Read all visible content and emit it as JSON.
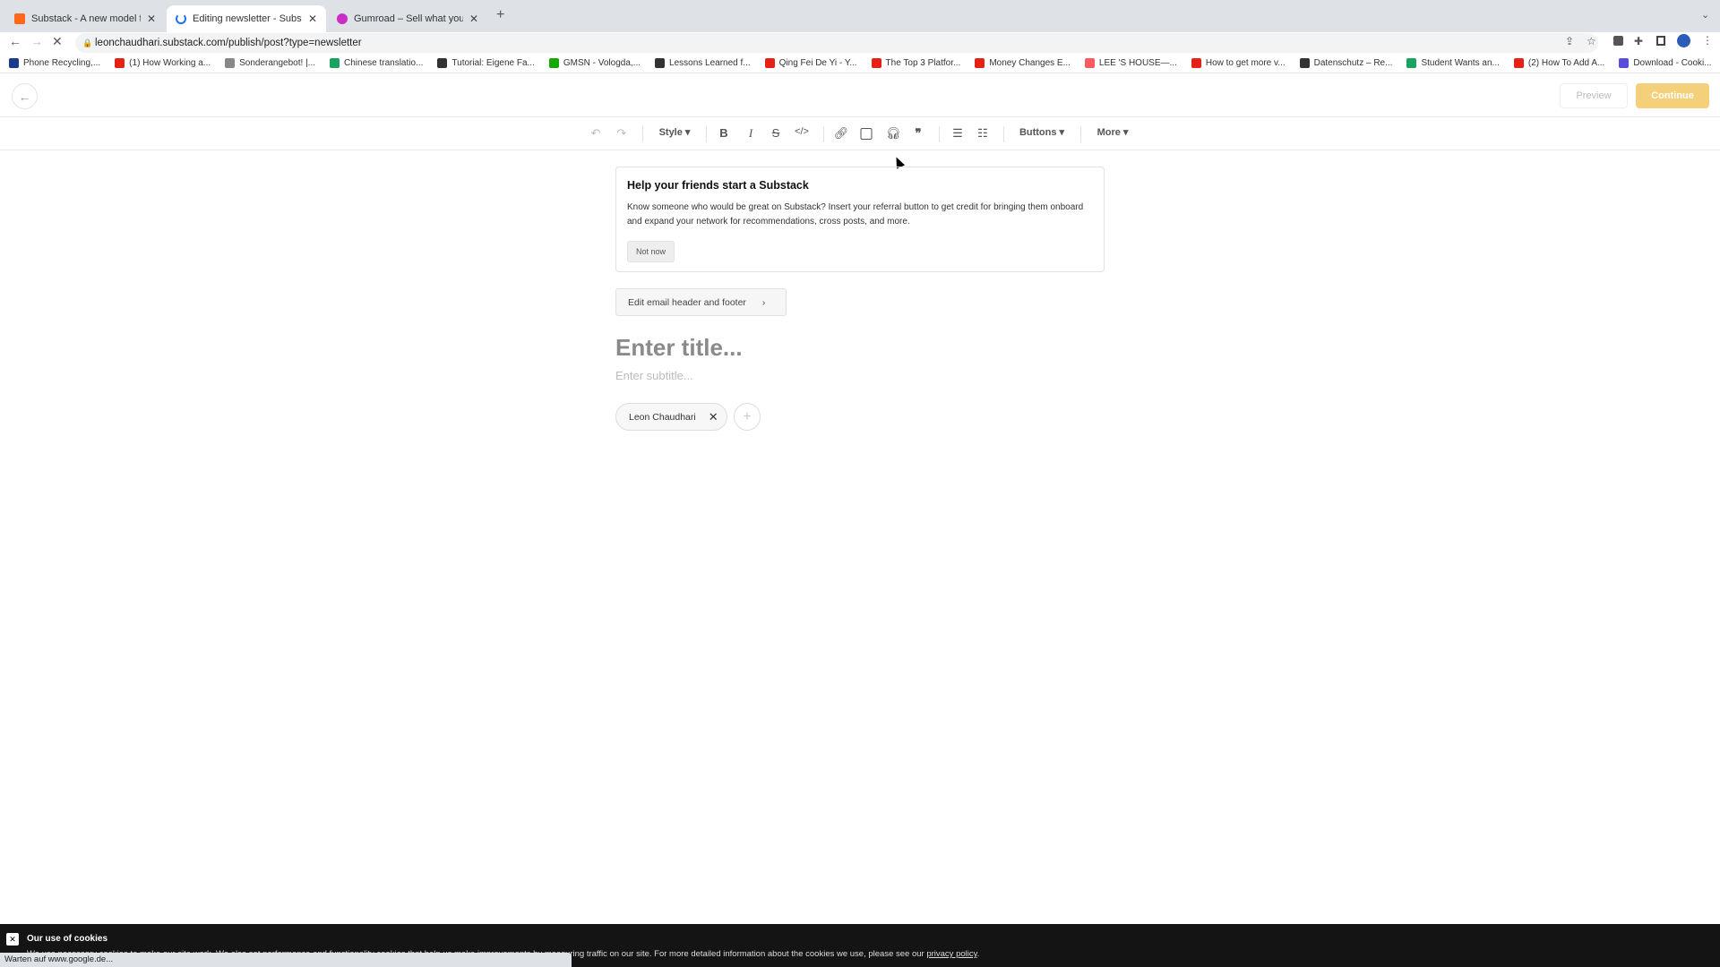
{
  "browser": {
    "tabs": [
      {
        "title": "Substack - A new model for pu",
        "icon": "substack-icon",
        "color": "#ff6719"
      },
      {
        "title": "Editing newsletter - Substack",
        "icon": "loading-spinner-icon",
        "color": "#1a73e8"
      },
      {
        "title": "Gumroad – Sell what you know",
        "icon": "gumroad-icon",
        "color": "#c92ec7"
      }
    ],
    "url": "leonchaudhari.substack.com/publish/post?type=newsletter",
    "bookmarks": [
      {
        "label": "Phone Recycling,...",
        "color": "#1a3a8a"
      },
      {
        "label": "(1) How Working a...",
        "color": "#e62117"
      },
      {
        "label": "Sonderangebot! |...",
        "color": "#888888"
      },
      {
        "label": "Chinese translatio...",
        "color": "#1aa260"
      },
      {
        "label": "Tutorial: Eigene Fa...",
        "color": "#333333"
      },
      {
        "label": "GMSN - Vologda,...",
        "color": "#14a800"
      },
      {
        "label": "Lessons Learned f...",
        "color": "#333333"
      },
      {
        "label": "Qing Fei De Yi - Y...",
        "color": "#e62117"
      },
      {
        "label": "The Top 3 Platfor...",
        "color": "#e62117"
      },
      {
        "label": "Money Changes E...",
        "color": "#e62117"
      },
      {
        "label": "LEE 'S HOUSE—...",
        "color": "#ff5a5f"
      },
      {
        "label": "How to get more v...",
        "color": "#e62117"
      },
      {
        "label": "Datenschutz – Re...",
        "color": "#333333"
      },
      {
        "label": "Student Wants an...",
        "color": "#1aa260"
      },
      {
        "label": "(2) How To Add A...",
        "color": "#e62117"
      },
      {
        "label": "Download - Cooki...",
        "color": "#5b4ddb"
      }
    ],
    "status": "Warten auf www.google.de..."
  },
  "header": {
    "preview": "Preview",
    "continue": "Continue",
    "accent": "#f5d07a"
  },
  "toolbar": {
    "style": "Style",
    "buttons": "Buttons",
    "more": "More"
  },
  "card": {
    "title": "Help your friends start a Substack",
    "body": "Know someone who would be great on Substack? Insert your referral button to get credit for bringing them onboard and expand your network for recommendations, cross posts, and more.",
    "dismiss": "Not now"
  },
  "editor": {
    "edit_header": "Edit email header and footer",
    "title_placeholder": "Enter title...",
    "subtitle_placeholder": "Enter subtitle...",
    "author": "Leon Chaudhari"
  },
  "cookie": {
    "title": "Our use of cookies",
    "body": "We use necessary cookies to make our site work. We also set performance and functionality cookies that help us make improvements by measuring traffic on our site. For more detailed information about the cookies we use, please see our ",
    "link": "privacy policy",
    "end": "."
  }
}
